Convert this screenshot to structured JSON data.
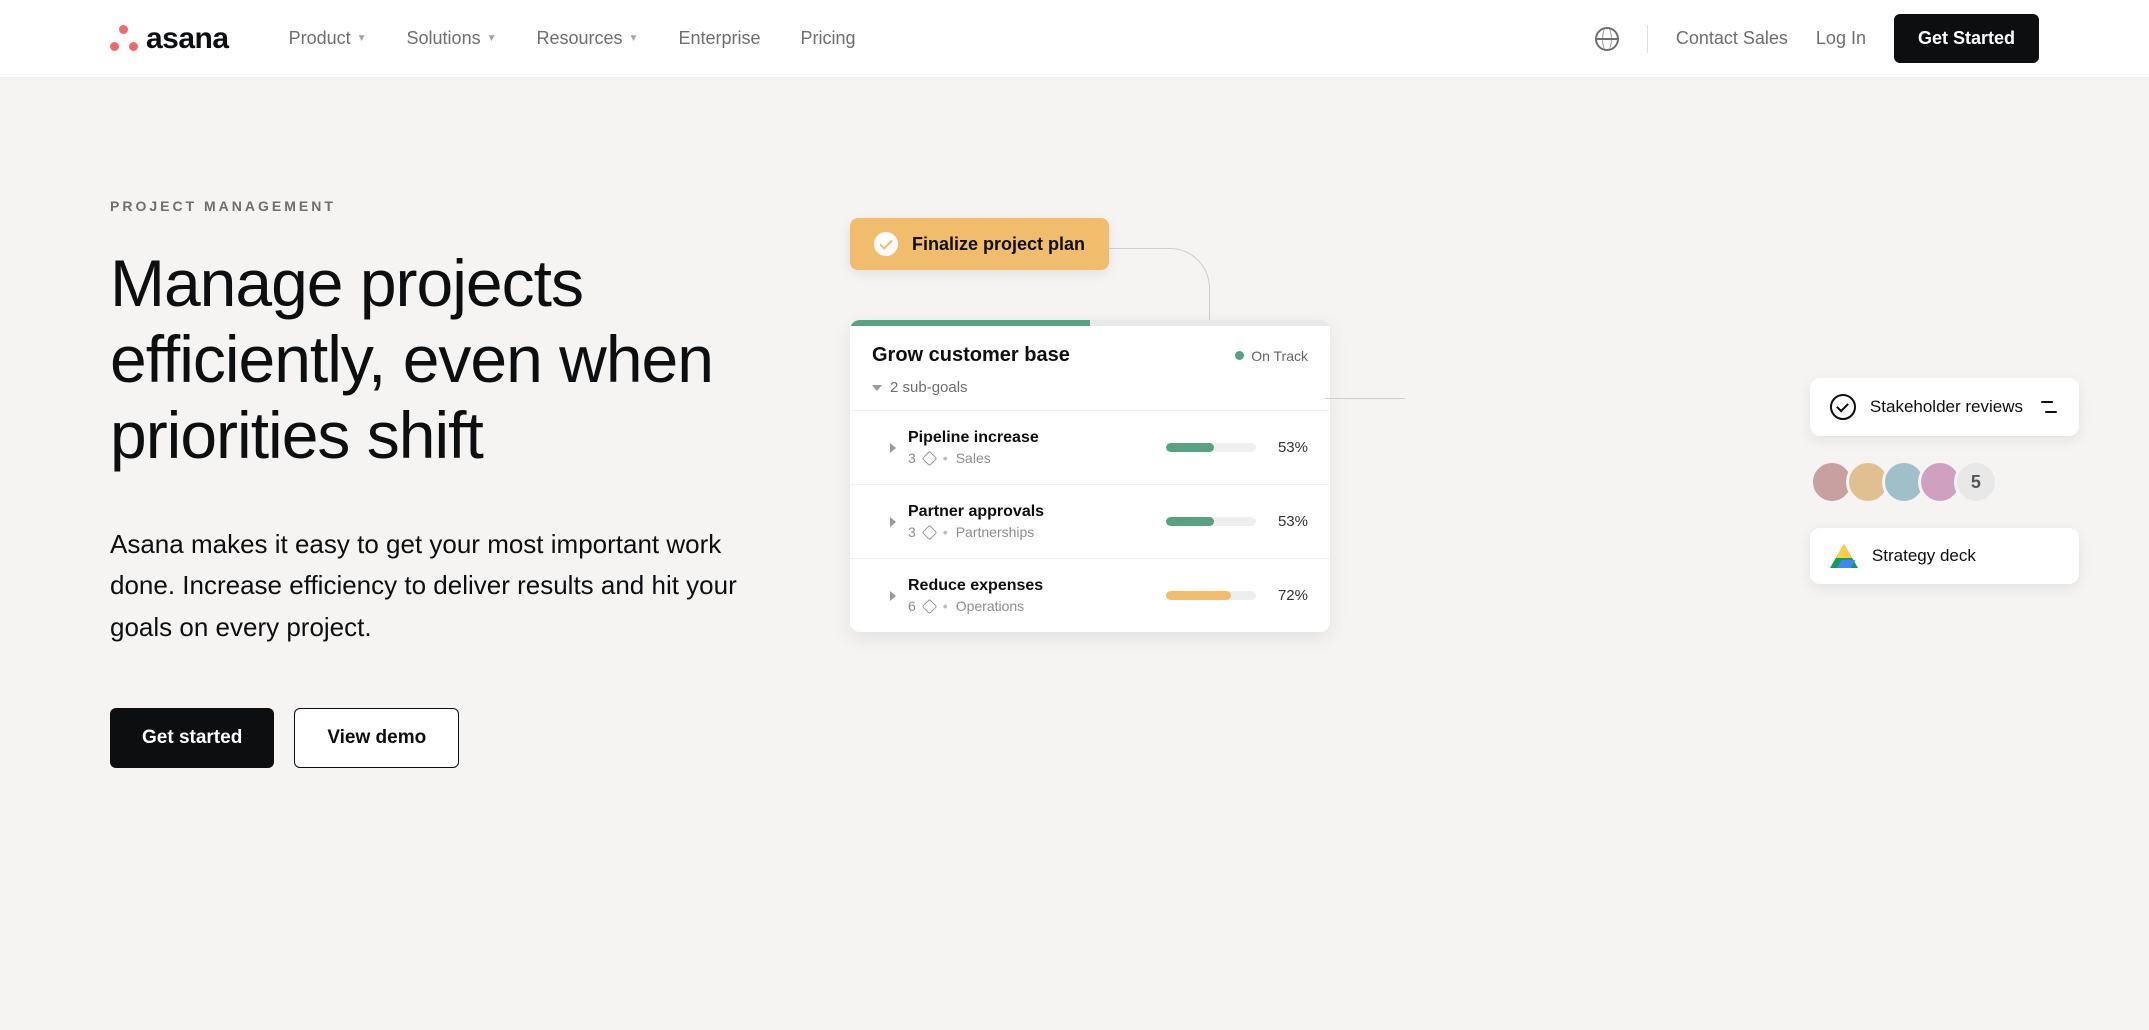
{
  "header": {
    "brand": "asana",
    "nav": {
      "product": "Product",
      "solutions": "Solutions",
      "resources": "Resources",
      "enterprise": "Enterprise",
      "pricing": "Pricing"
    },
    "contact_sales": "Contact Sales",
    "login": "Log In",
    "get_started": "Get Started"
  },
  "hero": {
    "eyebrow": "PROJECT MANAGEMENT",
    "title": "Manage projects efficiently, even when priorities shift",
    "subtitle": "Asana makes it easy to get your most important work done. Increase efficiency to deliver results and hit your goals on every project.",
    "cta_primary": "Get started",
    "cta_secondary": "View demo"
  },
  "illustration": {
    "pill_label": "Finalize project plan",
    "goal_title": "Grow customer base",
    "status_label": "On Track",
    "subgoal_toggle": "2 sub-goals",
    "subgoals": [
      {
        "name": "Pipeline increase",
        "count": "3",
        "dept": "Sales",
        "pct": "53%",
        "fill": 53,
        "color": "green"
      },
      {
        "name": "Partner approvals",
        "count": "3",
        "dept": "Partnerships",
        "pct": "53%",
        "fill": 53,
        "color": "green"
      },
      {
        "name": "Reduce expenses",
        "count": "6",
        "dept": "Operations",
        "pct": "72%",
        "fill": 72,
        "color": "orange"
      }
    ],
    "side": {
      "reviews": "Stakeholder reviews",
      "more_count": "5",
      "deck": "Strategy deck"
    },
    "avatar_colors": [
      "#c9a0a0",
      "#e0c090",
      "#a0c0c9",
      "#d0a0c0"
    ]
  }
}
